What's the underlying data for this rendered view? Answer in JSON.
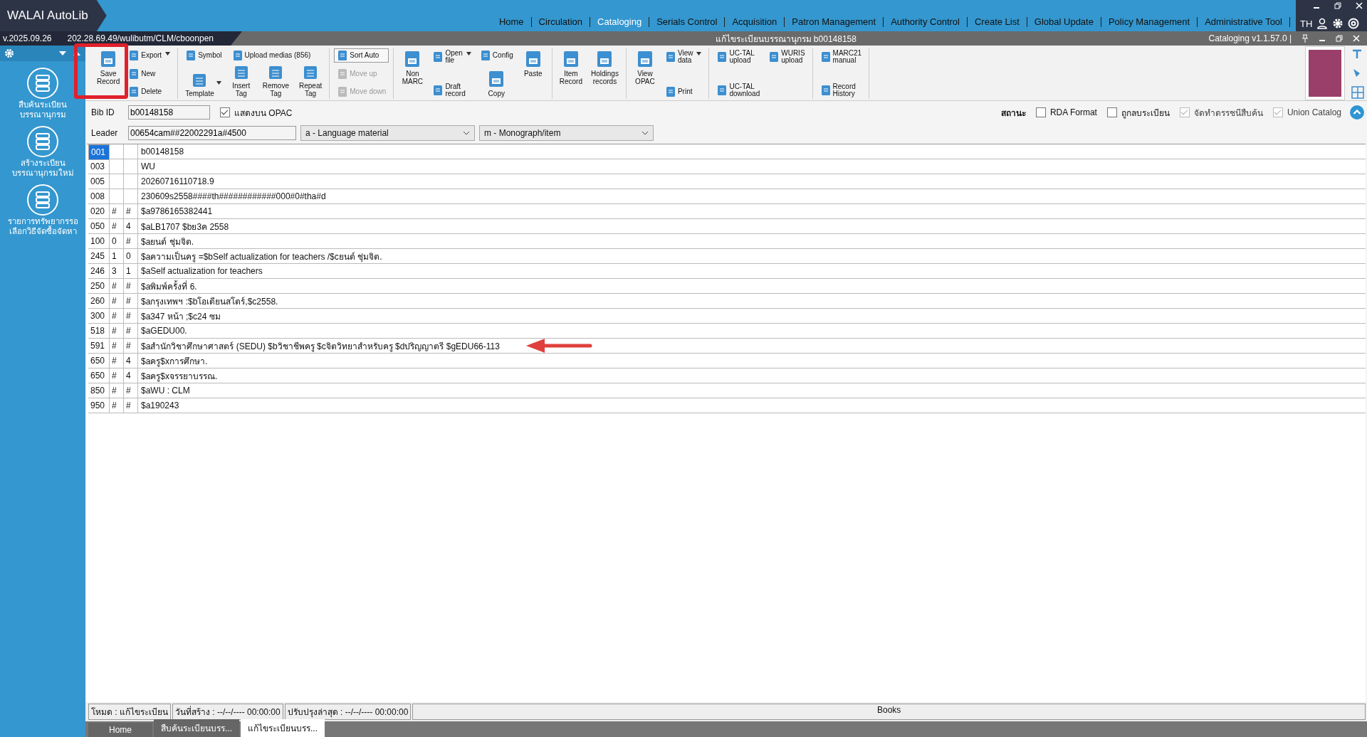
{
  "app": {
    "title": "WALAI AutoLib",
    "version": "v.2025.09.26",
    "path": "202.28.69.49/wulibutm/CLM/cboonpen",
    "language": "TH"
  },
  "nav": [
    {
      "label": "Home",
      "selected": false
    },
    {
      "label": "Circulation",
      "selected": false
    },
    {
      "label": "Cataloging",
      "selected": true
    },
    {
      "label": "Serials Control",
      "selected": false
    },
    {
      "label": "Acquisition",
      "selected": false
    },
    {
      "label": "Patron Management",
      "selected": false
    },
    {
      "label": "Authority Control",
      "selected": false
    },
    {
      "label": "Create List",
      "selected": false
    },
    {
      "label": "Global Update",
      "selected": false
    },
    {
      "label": "Policy Management",
      "selected": false
    },
    {
      "label": "Administrative Tool",
      "selected": false
    }
  ],
  "window": {
    "title": "แก้ไขระเบียนบรรณานุกรม b00148158",
    "module": "Cataloging v1.1.57.0 |"
  },
  "sidebar": {
    "items": [
      {
        "label": "สืบค้นระเบียน\nบรรณานุกรม"
      },
      {
        "label": "สร้างระเบียน\nบรรณานุกรมใหม่"
      },
      {
        "label": "รายการทรัพยากรรอ\nเลือกวิธีจัดซื้อจัดหา"
      }
    ]
  },
  "toolbar": {
    "groups": [
      {
        "kind": "columns",
        "columns": [
          [
            {
              "kind": "large",
              "label": "Save\nRecord"
            }
          ],
          [
            {
              "kind": "small",
              "label": "Export",
              "dropdown": true
            },
            {
              "kind": "small",
              "label": "New"
            },
            {
              "kind": "small",
              "label": "Delete"
            }
          ]
        ]
      },
      {
        "kind": "split",
        "top": [
          {
            "label": "Symbol"
          },
          {
            "label": "Upload medias (856)"
          }
        ],
        "bottom": [
          {
            "label": "Template",
            "dropdown": true
          },
          {
            "label": "Insert\nTag"
          },
          {
            "label": "Remove\nTag"
          },
          {
            "label": "Repeat\nTag"
          }
        ]
      },
      {
        "kind": "columns",
        "columns": [
          [
            {
              "kind": "toggle",
              "label": "Sort Auto",
              "on": true
            },
            {
              "kind": "small",
              "label": "Move up",
              "disabled": true
            },
            {
              "kind": "small",
              "label": "Move down",
              "disabled": true
            }
          ]
        ]
      },
      {
        "kind": "columns",
        "columns": [
          [
            {
              "kind": "large",
              "label": "Non\nMARC"
            }
          ],
          [
            {
              "kind": "small",
              "label": "Open\nfile",
              "dropdown": true
            },
            {
              "kind": "small",
              "label": "Draft\nrecord"
            }
          ],
          [
            {
              "kind": "small",
              "label": "Config"
            },
            {
              "kind": "large",
              "label": "Copy"
            }
          ],
          [
            {
              "kind": "large",
              "label": "Paste"
            }
          ]
        ]
      },
      {
        "kind": "columns",
        "columns": [
          [
            {
              "kind": "large",
              "label": "Item\nRecord"
            }
          ],
          [
            {
              "kind": "large",
              "label": "Holdings\nrecords"
            }
          ]
        ]
      },
      {
        "kind": "columns",
        "columns": [
          [
            {
              "kind": "large",
              "label": "View\nOPAC"
            }
          ],
          [
            {
              "kind": "small",
              "label": "View\ndata",
              "dropdown": true
            },
            {
              "kind": "small",
              "label": "Print"
            }
          ]
        ]
      },
      {
        "kind": "columns",
        "columns": [
          [
            {
              "kind": "small",
              "label": "UC-TAL\nupload"
            },
            {
              "kind": "small",
              "label": "UC-TAL\ndownload"
            }
          ],
          [
            {
              "kind": "small",
              "label": "WURIS\nupload"
            }
          ]
        ]
      },
      {
        "kind": "columns",
        "columns": [
          [
            {
              "kind": "small",
              "label": "MARC21\nmanual"
            },
            {
              "kind": "small",
              "label": "Record\nHistory"
            }
          ]
        ]
      }
    ]
  },
  "record": {
    "bib_id_label": "Bib ID",
    "bib_id": "b00148158",
    "show_opac": {
      "label": "แสดงบน OPAC",
      "checked": true
    },
    "leader_label": "Leader",
    "leader": "00654cam##22002291a#4500",
    "type": "a - Language material",
    "level": "m - Monograph/item",
    "status_label": "สถานะ",
    "flags": [
      {
        "label": "RDA Format",
        "checked": false,
        "disabled": false
      },
      {
        "label": "ถูกลบระเบียน",
        "checked": false,
        "disabled": false
      },
      {
        "label": "จัดทำดรรชนีสืบค้น",
        "checked": true,
        "disabled": true
      },
      {
        "label": "Union Catalog",
        "checked": true,
        "disabled": true
      }
    ]
  },
  "table": {
    "rows": [
      {
        "tag": "001",
        "ind1": "",
        "ind2": "",
        "data": "b00148158",
        "selected": true
      },
      {
        "tag": "003",
        "ind1": "",
        "ind2": "",
        "data": "WU",
        "selected": false
      },
      {
        "tag": "005",
        "ind1": "",
        "ind2": "",
        "data": "20260716110718.9",
        "selected": false
      },
      {
        "tag": "008",
        "ind1": "",
        "ind2": "",
        "data": "230609s2558####th############000#0#tha#d",
        "selected": false
      },
      {
        "tag": "020",
        "ind1": "#",
        "ind2": "#",
        "data": "$a9786165382441",
        "selected": false
      },
      {
        "tag": "050",
        "ind1": "#",
        "ind2": "4",
        "data": "$aLB1707 $bย3ค 2558",
        "selected": false
      },
      {
        "tag": "100",
        "ind1": "0",
        "ind2": "#",
        "data": "$aยนต์ ชุ่มจิต.",
        "selected": false
      },
      {
        "tag": "245",
        "ind1": "1",
        "ind2": "0",
        "data": "$aความเป็นครู =$bSelf actualization for teachers /$cยนต์ ชุ่มจิต.",
        "selected": false
      },
      {
        "tag": "246",
        "ind1": "3",
        "ind2": "1",
        "data": "$aSelf actualization for teachers",
        "selected": false
      },
      {
        "tag": "250",
        "ind1": "#",
        "ind2": "#",
        "data": "$aพิมพ์ครั้งที่ 6.",
        "selected": false
      },
      {
        "tag": "260",
        "ind1": "#",
        "ind2": "#",
        "data": "$aกรุงเทพฯ :$bโอเดียนสโตร์,$c2558.",
        "selected": false
      },
      {
        "tag": "300",
        "ind1": "#",
        "ind2": "#",
        "data": "$a347 หน้า ;$c24 ซม",
        "selected": false
      },
      {
        "tag": "518",
        "ind1": "#",
        "ind2": "#",
        "data": "$aGEDU00.",
        "selected": false
      },
      {
        "tag": "591",
        "ind1": "#",
        "ind2": "#",
        "data": "$aสำนักวิชาศึกษาศาสตร์ (SEDU) $bวิชาชีพครู $cจิตวิทยาสำหรับครู $dปริญญาตรี $gEDU66-113",
        "selected": false
      },
      {
        "tag": "650",
        "ind1": "#",
        "ind2": "4",
        "data": "$aครู$xการศึกษา.",
        "selected": false
      },
      {
        "tag": "650",
        "ind1": "#",
        "ind2": "4",
        "data": "$aครู$xจรรยาบรรณ.",
        "selected": false
      },
      {
        "tag": "850",
        "ind1": "#",
        "ind2": "#",
        "data": "$aWU : CLM",
        "selected": false
      },
      {
        "tag": "950",
        "ind1": "#",
        "ind2": "#",
        "data": "$a190243",
        "selected": false
      }
    ]
  },
  "status_bar": [
    "โหมด : แก้ไขระเบียน",
    "วันที่สร้าง :  --/--/---- 00:00:00",
    "ปรับปรุงล่าสุด :  --/--/---- 00:00:00",
    "Books"
  ],
  "bottom_tabs": [
    {
      "label": "Home",
      "selected": false
    },
    {
      "label": "สืบค้นระเบียนบรร...",
      "selected": false
    },
    {
      "label": "แก้ไขระเบียนบรร...",
      "selected": true
    }
  ]
}
